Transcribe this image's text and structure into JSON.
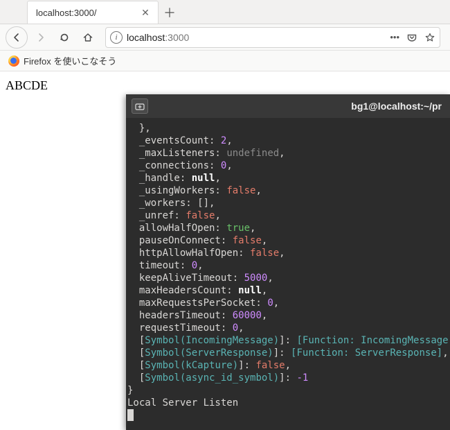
{
  "browser": {
    "tab_title": "localhost:3000/",
    "url_protocol_hint": "i",
    "url_host": "localhost",
    "url_port": ":3000",
    "bookmarks": [
      {
        "label": "Firefox を使いこなそう"
      }
    ]
  },
  "page": {
    "body_text": "ABCDE"
  },
  "terminal": {
    "title": "bg1@localhost:~/pr",
    "lines": [
      {
        "indent": 1,
        "tokens": [
          {
            "t": "punc",
            "v": "},"
          }
        ]
      },
      {
        "indent": 1,
        "tokens": [
          {
            "t": "key",
            "v": "_eventsCount:"
          },
          {
            "t": "space"
          },
          {
            "t": "num",
            "v": "2"
          },
          {
            "t": "punc",
            "v": ","
          }
        ]
      },
      {
        "indent": 1,
        "tokens": [
          {
            "t": "key",
            "v": "_maxListeners:"
          },
          {
            "t": "space"
          },
          {
            "t": "undef",
            "v": "undefined"
          },
          {
            "t": "punc",
            "v": ","
          }
        ]
      },
      {
        "indent": 1,
        "tokens": [
          {
            "t": "key",
            "v": "_connections:"
          },
          {
            "t": "space"
          },
          {
            "t": "num",
            "v": "0"
          },
          {
            "t": "punc",
            "v": ","
          }
        ]
      },
      {
        "indent": 1,
        "tokens": [
          {
            "t": "key",
            "v": "_handle:"
          },
          {
            "t": "space"
          },
          {
            "t": "null",
            "v": "null"
          },
          {
            "t": "punc",
            "v": ","
          }
        ]
      },
      {
        "indent": 1,
        "tokens": [
          {
            "t": "key",
            "v": "_usingWorkers:"
          },
          {
            "t": "space"
          },
          {
            "t": "false",
            "v": "false"
          },
          {
            "t": "punc",
            "v": ","
          }
        ]
      },
      {
        "indent": 1,
        "tokens": [
          {
            "t": "key",
            "v": "_workers:"
          },
          {
            "t": "space"
          },
          {
            "t": "punc",
            "v": "[],"
          }
        ]
      },
      {
        "indent": 1,
        "tokens": [
          {
            "t": "key",
            "v": "_unref:"
          },
          {
            "t": "space"
          },
          {
            "t": "false",
            "v": "false"
          },
          {
            "t": "punc",
            "v": ","
          }
        ]
      },
      {
        "indent": 1,
        "tokens": [
          {
            "t": "key",
            "v": "allowHalfOpen:"
          },
          {
            "t": "space"
          },
          {
            "t": "true",
            "v": "true"
          },
          {
            "t": "punc",
            "v": ","
          }
        ]
      },
      {
        "indent": 1,
        "tokens": [
          {
            "t": "key",
            "v": "pauseOnConnect:"
          },
          {
            "t": "space"
          },
          {
            "t": "false",
            "v": "false"
          },
          {
            "t": "punc",
            "v": ","
          }
        ]
      },
      {
        "indent": 1,
        "tokens": [
          {
            "t": "key",
            "v": "httpAllowHalfOpen:"
          },
          {
            "t": "space"
          },
          {
            "t": "false",
            "v": "false"
          },
          {
            "t": "punc",
            "v": ","
          }
        ]
      },
      {
        "indent": 1,
        "tokens": [
          {
            "t": "key",
            "v": "timeout:"
          },
          {
            "t": "space"
          },
          {
            "t": "num",
            "v": "0"
          },
          {
            "t": "punc",
            "v": ","
          }
        ]
      },
      {
        "indent": 1,
        "tokens": [
          {
            "t": "key",
            "v": "keepAliveTimeout:"
          },
          {
            "t": "space"
          },
          {
            "t": "num",
            "v": "5000"
          },
          {
            "t": "punc",
            "v": ","
          }
        ]
      },
      {
        "indent": 1,
        "tokens": [
          {
            "t": "key",
            "v": "maxHeadersCount:"
          },
          {
            "t": "space"
          },
          {
            "t": "null",
            "v": "null"
          },
          {
            "t": "punc",
            "v": ","
          }
        ]
      },
      {
        "indent": 1,
        "tokens": [
          {
            "t": "key",
            "v": "maxRequestsPerSocket:"
          },
          {
            "t": "space"
          },
          {
            "t": "num",
            "v": "0"
          },
          {
            "t": "punc",
            "v": ","
          }
        ]
      },
      {
        "indent": 1,
        "tokens": [
          {
            "t": "key",
            "v": "headersTimeout:"
          },
          {
            "t": "space"
          },
          {
            "t": "num",
            "v": "60000"
          },
          {
            "t": "punc",
            "v": ","
          }
        ]
      },
      {
        "indent": 1,
        "tokens": [
          {
            "t": "key",
            "v": "requestTimeout:"
          },
          {
            "t": "space"
          },
          {
            "t": "num",
            "v": "0"
          },
          {
            "t": "punc",
            "v": ","
          }
        ]
      },
      {
        "indent": 1,
        "tokens": [
          {
            "t": "punc",
            "v": "["
          },
          {
            "t": "sym",
            "v": "Symbol(IncomingMessage)"
          },
          {
            "t": "punc",
            "v": "]: "
          },
          {
            "t": "func",
            "v": "[Function: IncomingMessage]"
          },
          {
            "t": "punc",
            "v": ","
          }
        ]
      },
      {
        "indent": 1,
        "tokens": [
          {
            "t": "punc",
            "v": "["
          },
          {
            "t": "sym",
            "v": "Symbol(ServerResponse)"
          },
          {
            "t": "punc",
            "v": "]: "
          },
          {
            "t": "func",
            "v": "[Function: ServerResponse]"
          },
          {
            "t": "punc",
            "v": ","
          }
        ]
      },
      {
        "indent": 1,
        "tokens": [
          {
            "t": "punc",
            "v": "["
          },
          {
            "t": "sym",
            "v": "Symbol(kCapture)"
          },
          {
            "t": "punc",
            "v": "]: "
          },
          {
            "t": "false",
            "v": "false"
          },
          {
            "t": "punc",
            "v": ","
          }
        ]
      },
      {
        "indent": 1,
        "tokens": [
          {
            "t": "punc",
            "v": "["
          },
          {
            "t": "sym",
            "v": "Symbol(async_id_symbol)"
          },
          {
            "t": "punc",
            "v": "]: "
          },
          {
            "t": "neg",
            "v": "-1"
          }
        ]
      },
      {
        "indent": 0,
        "tokens": [
          {
            "t": "punc",
            "v": "}"
          }
        ]
      },
      {
        "indent": 0,
        "tokens": [
          {
            "t": "key",
            "v": "Local Server Listen"
          }
        ]
      }
    ]
  }
}
